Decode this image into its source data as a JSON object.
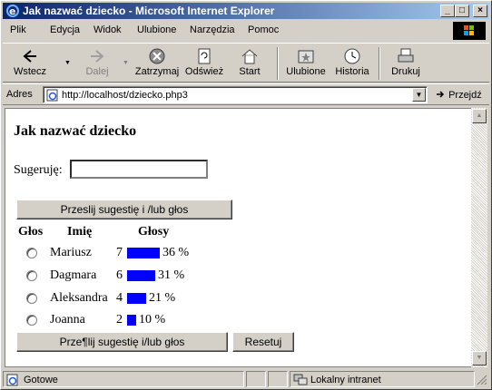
{
  "window": {
    "title": "Jak nazwać dziecko - Microsoft Internet Explorer",
    "controls": {
      "minimize": "_",
      "maximize": "□",
      "close": "×"
    }
  },
  "menu": [
    {
      "label": "Plik"
    },
    {
      "label": "Edycja"
    },
    {
      "label": "Widok"
    },
    {
      "label": "Ulubione"
    },
    {
      "label": "Narzędzia"
    },
    {
      "label": "Pomoc"
    }
  ],
  "toolbar": {
    "back": "Wstecz",
    "forward": "Dalej",
    "stop": "Zatrzymaj",
    "refresh": "Odśwież",
    "home": "Start",
    "favorites": "Ulubione",
    "history": "Historia",
    "print": "Drukuj"
  },
  "address": {
    "label": "Adres",
    "url": "http://localhost/dziecko.php3",
    "go": "Przejdź"
  },
  "page": {
    "title": "Jak nazwać dziecko",
    "suggest_label": "Sugeruję:",
    "suggest_value": "",
    "submit_top": "Przeslij sugestię i /lub głos",
    "headers": {
      "vote": "Głos",
      "name": "Imię",
      "votes": "Głosy"
    },
    "rows": [
      {
        "name": "Mariusz",
        "count": "7",
        "percent_label": "36 %",
        "percent": 36
      },
      {
        "name": "Dagmara",
        "count": "6",
        "percent_label": "31 %",
        "percent": 31
      },
      {
        "name": "Aleksandra",
        "count": "4",
        "percent_label": "21 %",
        "percent": 21
      },
      {
        "name": "Joanna",
        "count": "2",
        "percent_label": "10 %",
        "percent": 10
      }
    ],
    "submit_bottom": "Prze¶lij sugestię i/lub głos",
    "reset": "Resetuj"
  },
  "status": {
    "text": "Gotowe",
    "zone": "Lokalny intranet"
  },
  "colors": {
    "bar": "#0000ff",
    "titlebar_start": "#0a246a",
    "titlebar_end": "#a6caf0"
  }
}
